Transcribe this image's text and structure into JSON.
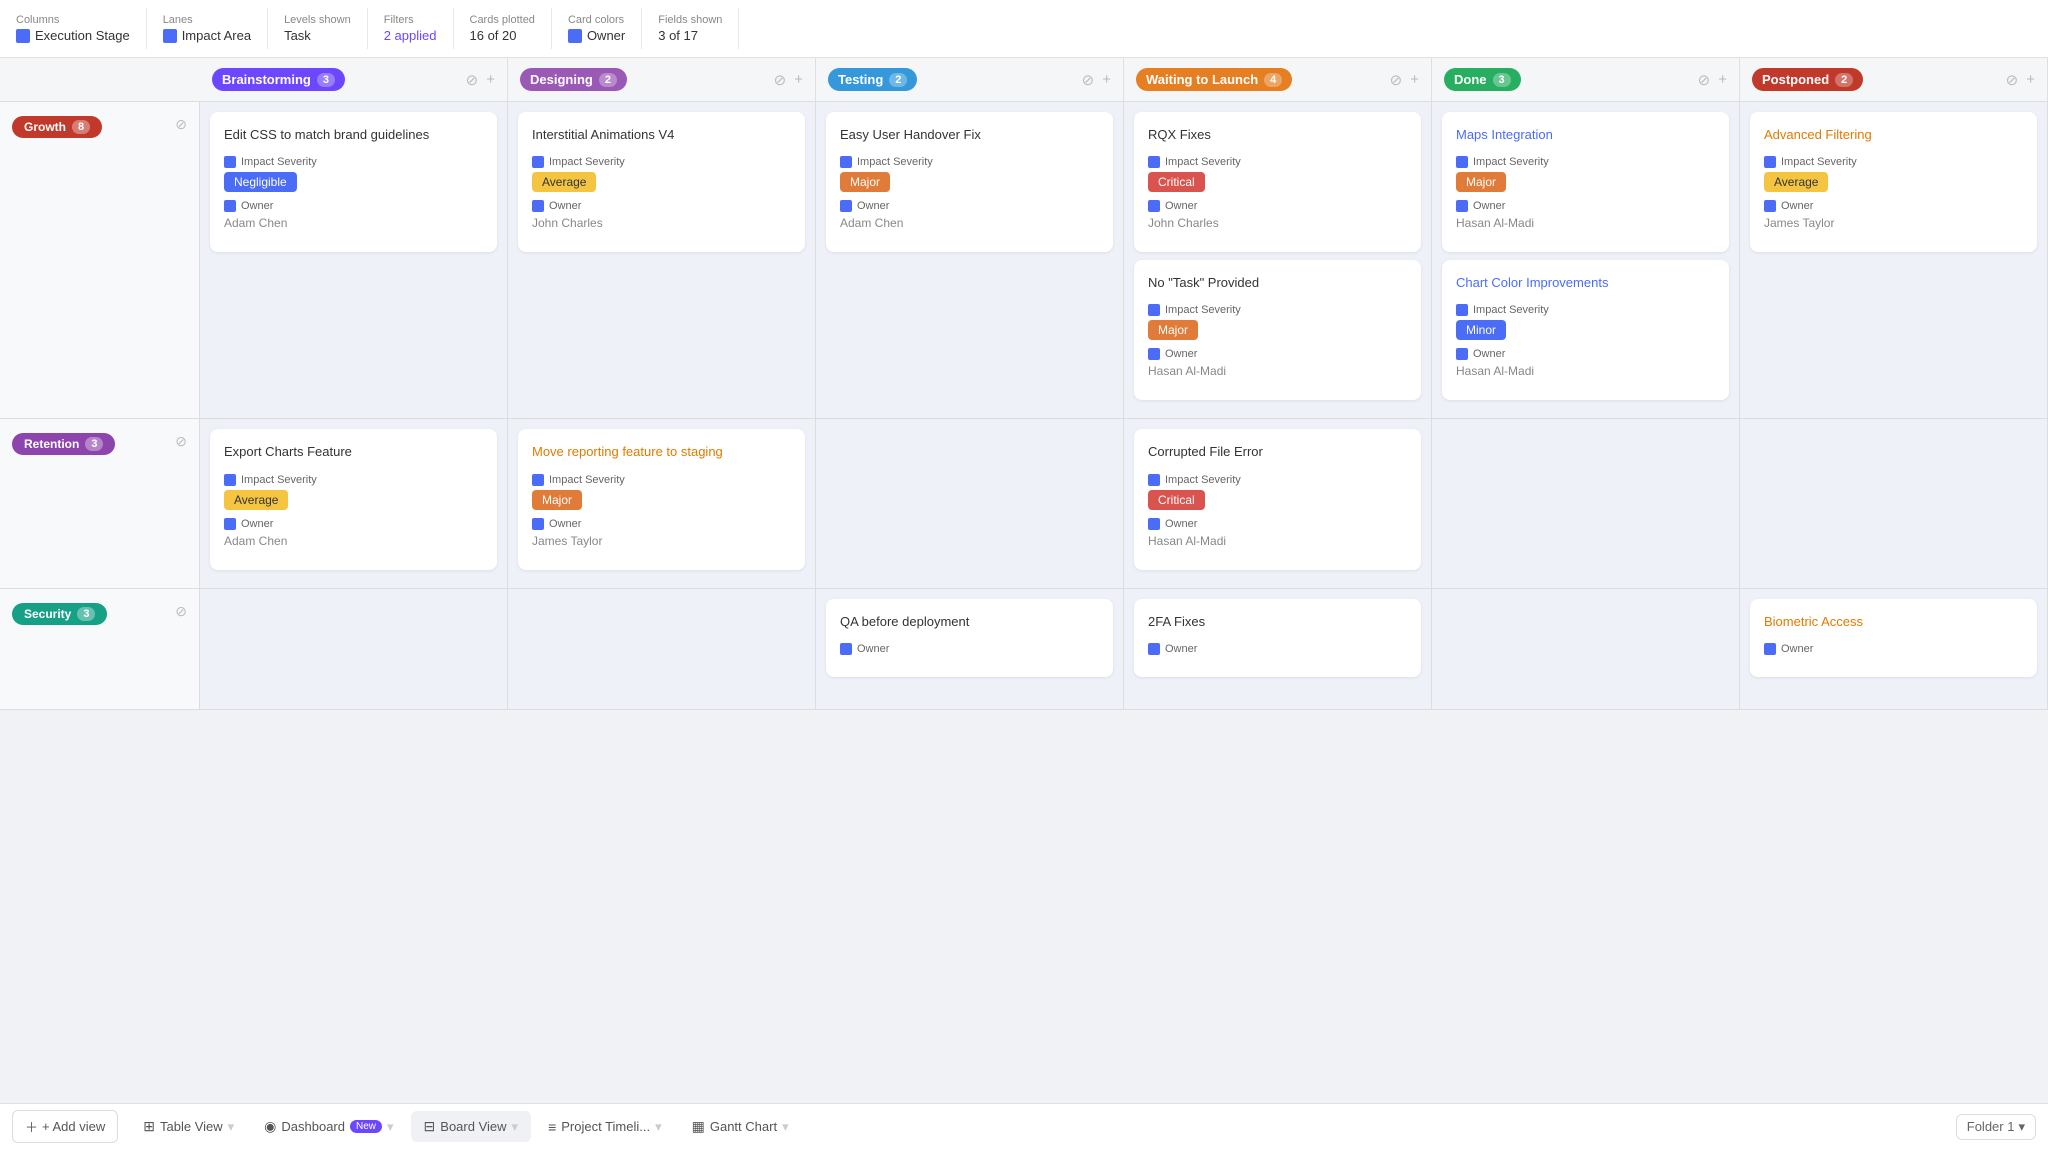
{
  "toolbar": {
    "columns_label": "Columns",
    "columns_value": "Execution Stage",
    "lanes_label": "Lanes",
    "lanes_value": "Impact Area",
    "levels_label": "Levels shown",
    "levels_value": "Task",
    "filters_label": "Filters",
    "filters_value": "2 applied",
    "cards_label": "Cards plotted",
    "cards_value": "16 of 20",
    "card_colors_label": "Card colors",
    "card_colors_value": "Owner",
    "fields_label": "Fields shown",
    "fields_value": "3 of 17"
  },
  "columns": [
    {
      "id": "brainstorming",
      "label": "Brainstorming",
      "count": 3,
      "color": "#6c47ff"
    },
    {
      "id": "designing",
      "label": "Designing",
      "count": 2,
      "color": "#9b59b6"
    },
    {
      "id": "testing",
      "label": "Testing",
      "count": 2,
      "color": "#3498db"
    },
    {
      "id": "waiting",
      "label": "Waiting to Launch",
      "count": 4,
      "color": "#e67e22"
    },
    {
      "id": "done",
      "label": "Done",
      "count": 3,
      "color": "#27ae60"
    },
    {
      "id": "postponed",
      "label": "Postponed",
      "count": 2,
      "color": "#c0392b"
    }
  ],
  "lanes": [
    {
      "id": "growth",
      "label": "Growth",
      "count": 8,
      "color": "#c0392b",
      "cells": [
        {
          "col": "brainstorming",
          "cards": [
            {
              "title": "Edit CSS to match brand guidelines",
              "title_style": "normal",
              "severity_label": "Negligible",
              "severity_class": "severity-negligible",
              "owner_label": "Adam Chen"
            }
          ]
        },
        {
          "col": "designing",
          "cards": [
            {
              "title": "Interstitial Animations V4",
              "title_style": "normal",
              "severity_label": "Average",
              "severity_class": "severity-average",
              "owner_label": "John Charles"
            }
          ]
        },
        {
          "col": "testing",
          "cards": [
            {
              "title": "Easy User Handover Fix",
              "title_style": "normal",
              "severity_label": "Major",
              "severity_class": "severity-major",
              "owner_label": "Adam Chen"
            }
          ]
        },
        {
          "col": "waiting",
          "cards": [
            {
              "title": "RQX Fixes",
              "title_style": "normal",
              "severity_label": "Critical",
              "severity_class": "severity-critical",
              "owner_label": "John Charles"
            },
            {
              "title": "No \"Task\" Provided",
              "title_style": "normal",
              "severity_label": "Major",
              "severity_class": "severity-major",
              "owner_label": "Hasan Al-Madi"
            }
          ]
        },
        {
          "col": "done",
          "cards": [
            {
              "title": "Maps Integration",
              "title_style": "blue",
              "severity_label": "Major",
              "severity_class": "severity-major",
              "owner_label": "Hasan Al-Madi"
            },
            {
              "title": "Chart Color Improvements",
              "title_style": "blue",
              "severity_label": "Minor",
              "severity_class": "severity-minor",
              "owner_label": "Hasan Al-Madi"
            }
          ]
        },
        {
          "col": "postponed",
          "cards": [
            {
              "title": "Advanced Filtering",
              "title_style": "orange",
              "severity_label": "Average",
              "severity_class": "severity-average",
              "owner_label": "James Taylor"
            }
          ]
        }
      ]
    },
    {
      "id": "retention",
      "label": "Retention",
      "count": 3,
      "color": "#8e44ad",
      "cells": [
        {
          "col": "brainstorming",
          "cards": [
            {
              "title": "Export Charts Feature",
              "title_style": "normal",
              "severity_label": "Average",
              "severity_class": "severity-average",
              "owner_label": "Adam Chen"
            }
          ]
        },
        {
          "col": "designing",
          "cards": [
            {
              "title": "Move reporting feature to staging",
              "title_style": "orange",
              "severity_label": "Major",
              "severity_class": "severity-major",
              "owner_label": "James Taylor"
            }
          ]
        },
        {
          "col": "testing",
          "cards": []
        },
        {
          "col": "waiting",
          "cards": [
            {
              "title": "Corrupted File Error",
              "title_style": "normal",
              "severity_label": "Critical",
              "severity_class": "severity-critical",
              "owner_label": "Hasan Al-Madi"
            }
          ]
        },
        {
          "col": "done",
          "cards": []
        },
        {
          "col": "postponed",
          "cards": []
        }
      ]
    },
    {
      "id": "security",
      "label": "Security",
      "count": 3,
      "color": "#16a085",
      "cells": [
        {
          "col": "brainstorming",
          "cards": []
        },
        {
          "col": "designing",
          "cards": []
        },
        {
          "col": "testing",
          "cards": [
            {
              "title": "QA before deployment",
              "title_style": "normal",
              "severity_label": "",
              "severity_class": "",
              "owner_label": ""
            }
          ]
        },
        {
          "col": "waiting",
          "cards": [
            {
              "title": "2FA Fixes",
              "title_style": "normal",
              "severity_label": "",
              "severity_class": "",
              "owner_label": ""
            }
          ]
        },
        {
          "col": "done",
          "cards": []
        },
        {
          "col": "postponed",
          "cards": [
            {
              "title": "Biometric Access",
              "title_style": "orange",
              "severity_label": "",
              "severity_class": "",
              "owner_label": ""
            }
          ]
        }
      ]
    }
  ],
  "bottom_tabs": {
    "add_view": "+ Add view",
    "table_view": "Table View",
    "dashboard": "Dashboard",
    "dashboard_badge": "New",
    "board_view": "Board View",
    "project_timeline": "Project Timeli...",
    "gantt_chart": "Gantt Chart",
    "folder": "Folder 1"
  },
  "field_label_impact": "Impact Severity",
  "field_label_owner": "Owner"
}
